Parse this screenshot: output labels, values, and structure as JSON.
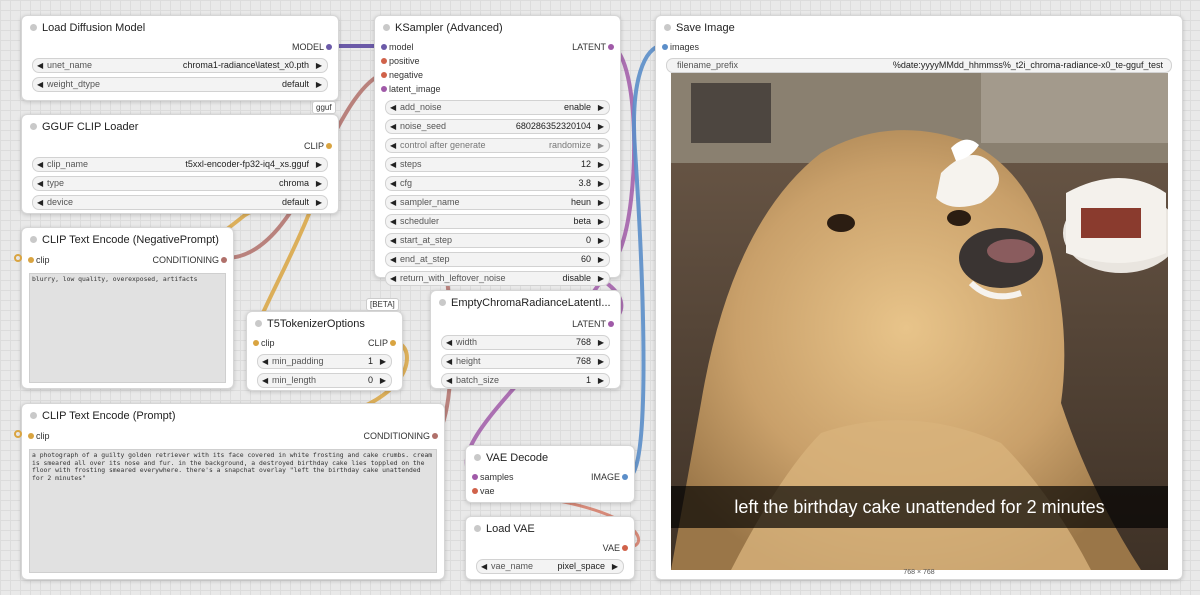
{
  "nodes": {
    "load_diffusion": {
      "title": "Load Diffusion Model",
      "output_model": "MODEL",
      "unet_name": {
        "name": "unet_name",
        "value": "chroma1-radiance\\latest_x0.pth"
      },
      "weight_dtype": {
        "name": "weight_dtype",
        "value": "default"
      },
      "badge": "gguf"
    },
    "gguf_clip": {
      "title": "GGUF CLIP Loader",
      "output_clip": "CLIP",
      "clip_name": {
        "name": "clip_name",
        "value": "t5xxl-encoder-fp32-iq4_xs.gguf"
      },
      "type": {
        "name": "type",
        "value": "chroma"
      },
      "device": {
        "name": "device",
        "value": "default"
      }
    },
    "clip_neg": {
      "title": "CLIP Text Encode (NegativePrompt)",
      "input_clip": "clip",
      "output": "CONDITIONING",
      "text": "blurry, low quality, overexposed, artifacts"
    },
    "t5_options": {
      "title": "T5TokenizerOptions",
      "badge": "[BETA]",
      "input_clip": "clip",
      "output_clip": "CLIP",
      "min_padding": {
        "name": "min_padding",
        "value": "1"
      },
      "min_length": {
        "name": "min_length",
        "value": "0"
      }
    },
    "clip_pos": {
      "title": "CLIP Text Encode (Prompt)",
      "input_clip": "clip",
      "output": "CONDITIONING",
      "text": "a photograph of a guilty golden retriever with its face covered in white frosting and cake crumbs. cream is smeared all over its nose and fur. in the background, a destroyed birthday cake lies toppled on the floor with frosting smeared everywhere. there's a snapchat overlay \"left the birthday cake unattended for 2 minutes\""
    },
    "ksampler": {
      "title": "KSampler (Advanced)",
      "inputs": [
        "model",
        "positive",
        "negative",
        "latent_image"
      ],
      "output": "LATENT",
      "widgets": [
        {
          "name": "add_noise",
          "value": "enable",
          "dim": false
        },
        {
          "name": "noise_seed",
          "value": "680286352320104",
          "dim": false
        },
        {
          "name": "control after generate",
          "value": "randomize",
          "dim": true
        },
        {
          "name": "steps",
          "value": "12",
          "dim": false
        },
        {
          "name": "cfg",
          "value": "3.8",
          "dim": false
        },
        {
          "name": "sampler_name",
          "value": "heun",
          "dim": false
        },
        {
          "name": "scheduler",
          "value": "beta",
          "dim": false
        },
        {
          "name": "start_at_step",
          "value": "0",
          "dim": false
        },
        {
          "name": "end_at_step",
          "value": "60",
          "dim": false
        },
        {
          "name": "return_with_leftover_noise",
          "value": "disable",
          "dim": false
        }
      ]
    },
    "empty_latent": {
      "title": "EmptyChromaRadianceLatentI...",
      "output": "LATENT",
      "width": {
        "name": "width",
        "value": "768"
      },
      "height": {
        "name": "height",
        "value": "768"
      },
      "batch_size": {
        "name": "batch_size",
        "value": "1"
      }
    },
    "vae_decode": {
      "title": "VAE Decode",
      "input_samples": "samples",
      "input_vae": "vae",
      "output": "IMAGE"
    },
    "load_vae": {
      "title": "Load VAE",
      "output": "VAE",
      "vae_name": {
        "name": "vae_name",
        "value": "pixel_space"
      }
    },
    "save_image": {
      "title": "Save Image",
      "input_images": "images",
      "filename_prefix": {
        "name": "filename_prefix",
        "value": "%date:yyyyMMdd_hhmmss%_t2i_chroma-radiance-x0_te-gguf_test"
      },
      "image_caption": "left the birthday cake unattended for 2 minutes",
      "image_size": "768 × 768"
    }
  },
  "colors": {
    "canvas_bg": "#e9e9e9",
    "model_wire": "#6b5aa8",
    "clip_wire": "#d9a441",
    "conditioning_wire": "#b0706a",
    "latent_wire": "#a05aa8",
    "image_wire": "#5b8ec9",
    "vae_wire": "#d0624a"
  }
}
